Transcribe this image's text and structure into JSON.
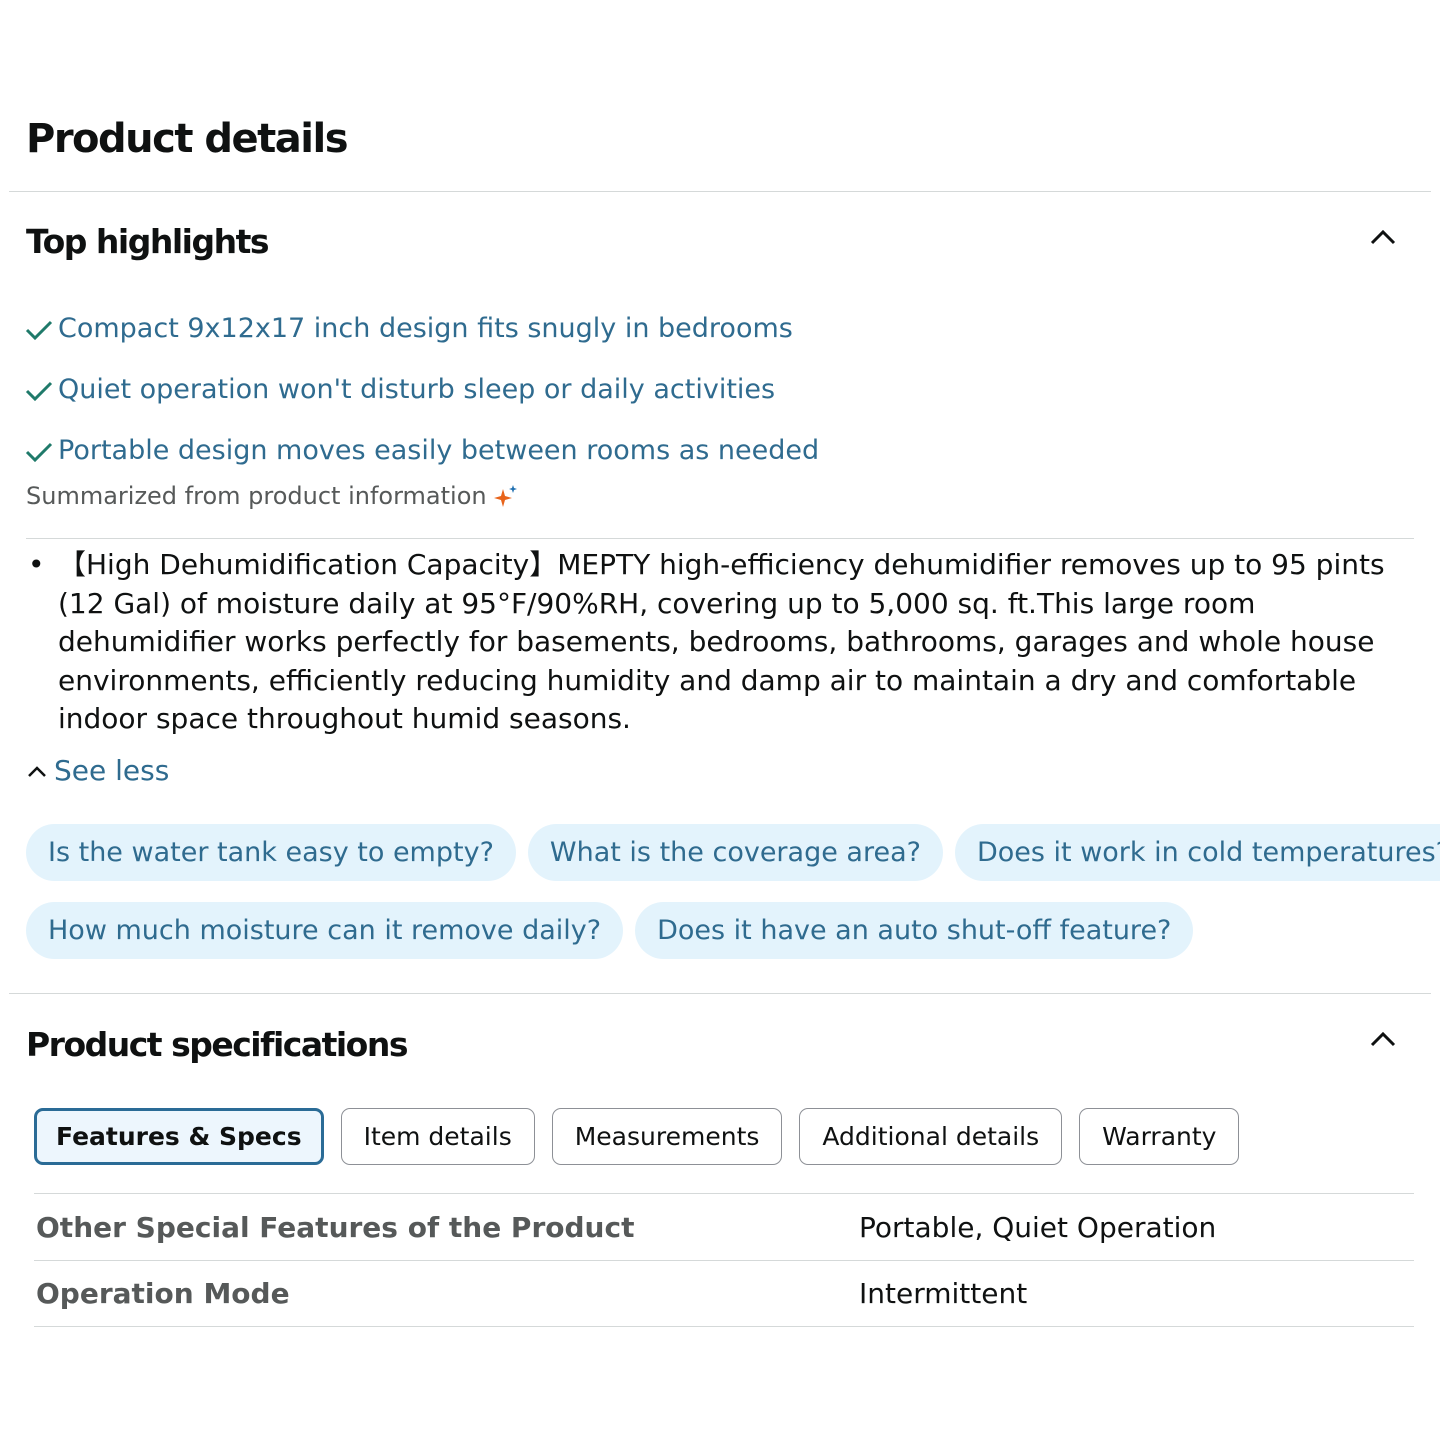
{
  "page": {
    "title": "Product details"
  },
  "top_highlights": {
    "title": "Top highlights",
    "items": [
      "Compact 9x12x17 inch design fits snugly in bedrooms",
      "Quiet operation won't disturb sleep or daily activities",
      "Portable design moves easily between rooms as needed"
    ],
    "summary": "Summarized from product information",
    "accent_color": "#2f6b8f",
    "check_color": "#1f7a6a"
  },
  "about": {
    "bullets": [
      "【High Dehumidification Capacity】MEPTY high-efficiency dehumidifier removes up to 95 pints (12 Gal) of moisture daily at 95°F/90%RH, covering up to 5,000 sq. ft.This large room dehumidifier works perfectly for basements, bedrooms, bathrooms, garages and whole house environments, efficiently reducing humidity and damp air to maintain a dry and comfortable indoor space throughout humid seasons."
    ],
    "see_less": "See less"
  },
  "questions": {
    "row1": [
      "Is the water tank easy to empty?",
      "What is the coverage area?",
      "Does it work in cold temperatures?"
    ],
    "row2": [
      "How much moisture can it remove daily?",
      "Does it have an auto shut-off feature?"
    ]
  },
  "specifications": {
    "title": "Product specifications",
    "tabs": [
      "Features & Specs",
      "Item details",
      "Measurements",
      "Additional details",
      "Warranty"
    ],
    "active_tab": "Features & Specs",
    "rows": [
      {
        "label": "Other Special Features of the Product",
        "value": "Portable, Quiet Operation"
      },
      {
        "label": "Operation Mode",
        "value": "Intermittent"
      }
    ]
  }
}
